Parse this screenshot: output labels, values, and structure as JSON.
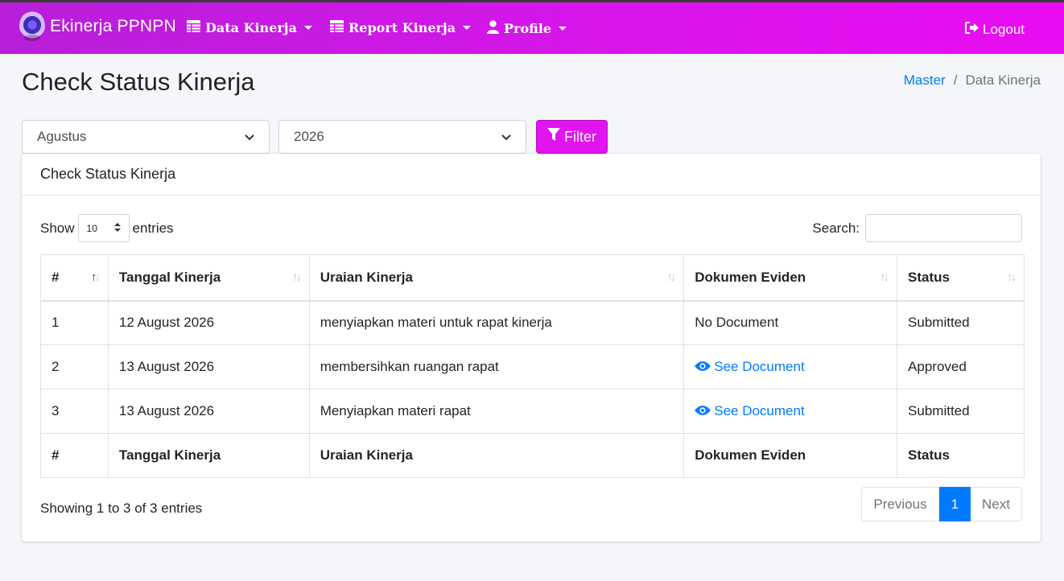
{
  "navbar": {
    "brand": "Ekinerja PPNPN",
    "items": [
      {
        "label": "Data Kinerja",
        "icon": "table-icon"
      },
      {
        "label": "Report Kinerja",
        "icon": "table-icon"
      },
      {
        "label": "Profile",
        "icon": "user-icon"
      }
    ],
    "logout": "Logout"
  },
  "page": {
    "title": "Check Status Kinerja",
    "breadcrumb": [
      "Master",
      "Data Kinerja"
    ]
  },
  "filters": {
    "month": "Agustus",
    "year": "2026",
    "button": "Filter"
  },
  "card": {
    "title": "Check Status Kinerja",
    "show_label": "Show",
    "entries_value": "10",
    "entries_label": "entries",
    "search_label": "Search:",
    "columns": [
      "#",
      "Tanggal Kinerja",
      "Uraian Kinerja",
      "Dokumen Eviden",
      "Status"
    ],
    "rows": [
      {
        "no": "1",
        "tanggal": "12 August 2026",
        "uraian": "menyiapkan materi untuk rapat kinerja",
        "dokumen": "No Document",
        "status": "Submitted"
      },
      {
        "no": "2",
        "tanggal": "13 August 2026",
        "uraian": "membersihkan ruangan rapat",
        "dokumen": "See Document",
        "status": "Approved"
      },
      {
        "no": "3",
        "tanggal": "13 August 2026",
        "uraian": "Menyiapkan materi rapat",
        "dokumen": "See Document",
        "status": "Submitted"
      }
    ],
    "info": "Showing 1 to 3 of 3 entries",
    "pagination": {
      "previous": "Previous",
      "current": "1",
      "next": "Next"
    }
  },
  "colors": {
    "navbar_start": "#b71fd9",
    "navbar_end": "#ea0cf2",
    "accent": "#e214ef",
    "link": "#007bff"
  }
}
